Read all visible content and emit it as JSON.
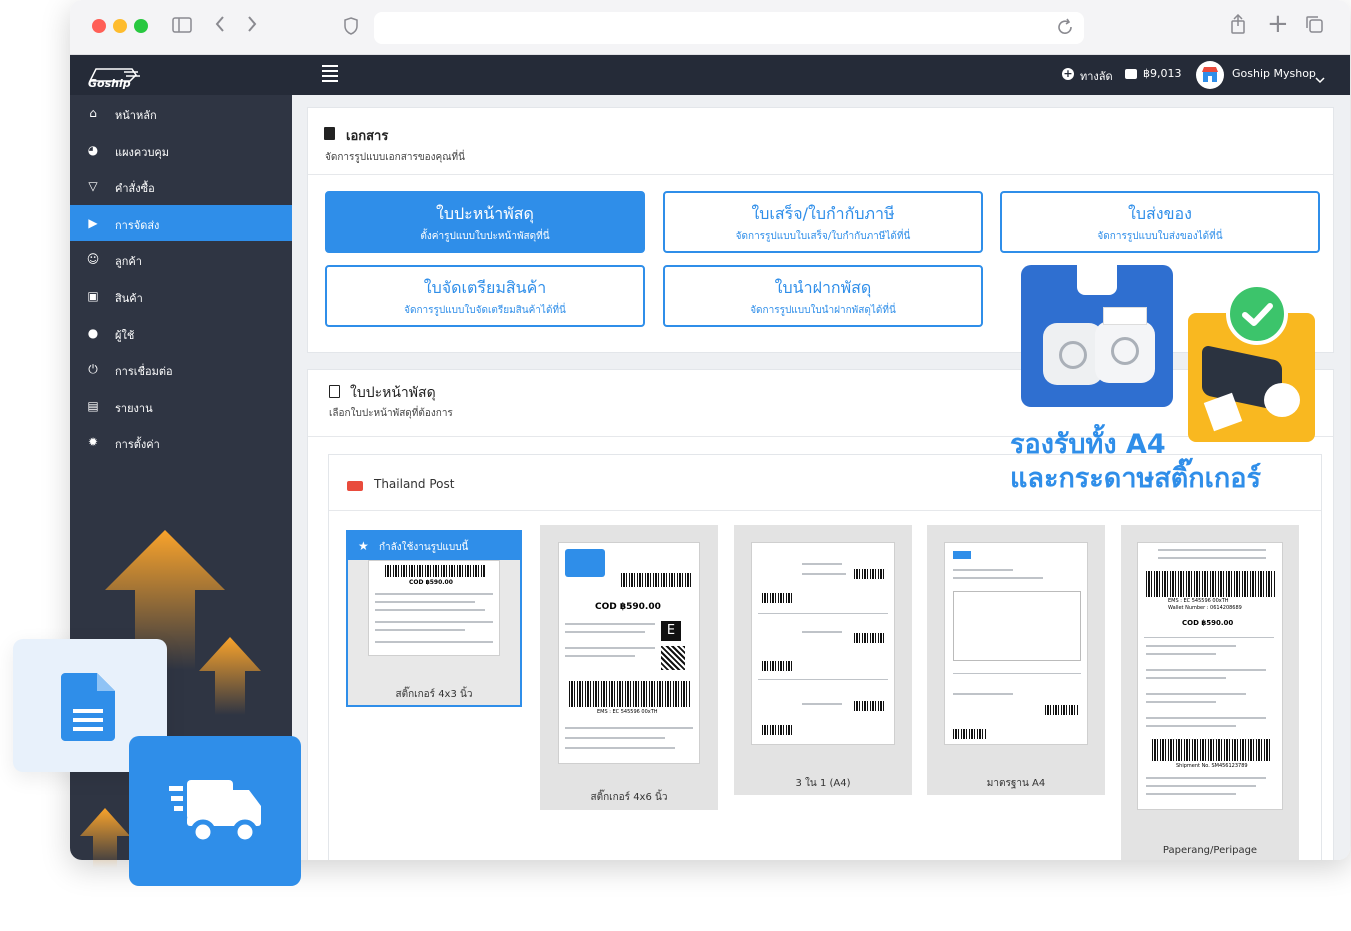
{
  "header": {
    "shortcut_label": "ทางลัด",
    "balance": "฿9,013",
    "shop_name": "Goship Myshop"
  },
  "logo_text": "Goship",
  "sidebar": {
    "items": [
      {
        "label": "หน้าหลัก",
        "icon": "home-icon",
        "glyph": "⌂"
      },
      {
        "label": "แผงควบคุม",
        "icon": "dashboard-icon",
        "glyph": "◕"
      },
      {
        "label": "คำสั่งซื้อ",
        "icon": "cart-icon",
        "glyph": "▽"
      },
      {
        "label": "การจัดส่ง",
        "icon": "truck-icon",
        "glyph": "▶"
      },
      {
        "label": "ลูกค้า",
        "icon": "users-icon",
        "glyph": "☺"
      },
      {
        "label": "สินค้า",
        "icon": "box-icon",
        "glyph": "▣"
      },
      {
        "label": "ผู้ใช้",
        "icon": "user-icon",
        "glyph": "●"
      },
      {
        "label": "การเชื่อมต่อ",
        "icon": "plug-icon",
        "glyph": "⏻"
      },
      {
        "label": "รายงาน",
        "icon": "report-icon",
        "glyph": "▤"
      },
      {
        "label": "การตั้งค่า",
        "icon": "gear-icon",
        "glyph": "✹"
      }
    ],
    "active_index": 3
  },
  "documents": {
    "title": "เอกสาร",
    "subtitle": "จัดการรูปแบบเอกสารของคุณที่นี่",
    "buttons": [
      {
        "title": "ใบปะหน้าพัสดุ",
        "sub": "ตั้งค่ารูปแบบใบปะหน้าพัสดุที่นี่"
      },
      {
        "title": "ใบเสร็จ/ใบกำกับภาษี",
        "sub": "จัดการรูปแบบใบเสร็จ/ใบกำกับภาษีได้ที่นี่"
      },
      {
        "title": "ใบส่งของ",
        "sub": "จัดการรูปแบบใบส่งของได้ที่นี่"
      },
      {
        "title": "ใบจัดเตรียมสินค้า",
        "sub": "จัดการรูปแบบใบจัดเตรียมสินค้าได้ที่นี่"
      },
      {
        "title": "ใบนำฝากพัสดุ",
        "sub": "จัดการรูปแบบใบนำฝากพัสดุได้ที่นี่"
      }
    ]
  },
  "labels": {
    "title": "ใบปะหน้าพัสดุ",
    "subtitle": "เลือกใบปะหน้าพัสดุที่ต้องการ",
    "carrier": "Thailand Post",
    "in_use_badge": "กำลังใช้งานรูปแบบนี้",
    "templates": [
      {
        "caption": "สติ๊กเกอร์ 4x3 นิ้ว"
      },
      {
        "caption": "สติ๊กเกอร์ 4x6 นิ้ว"
      },
      {
        "caption": "3 ใน 1 (A4)"
      },
      {
        "caption": "มาตรฐาน A4"
      },
      {
        "caption": "Paperang/Peripage"
      }
    ]
  },
  "label_texts": {
    "cod": "COD ฿590.00",
    "ems": "EMS : EC 545596 00xTH",
    "wallet": "Wallet Number : 0614208689",
    "shipment": "Shipment No. SM456123789",
    "e_badge": "E"
  },
  "promo": {
    "line1": "รองรับทั้ง A4",
    "line2": "และกระดาษสติ๊กเกอร์"
  },
  "colors": {
    "accent": "#2f8ee9",
    "sidebar": "#2f3543",
    "header": "#252b38",
    "yellow": "#f9b820",
    "check_green": "#3cc46b"
  }
}
